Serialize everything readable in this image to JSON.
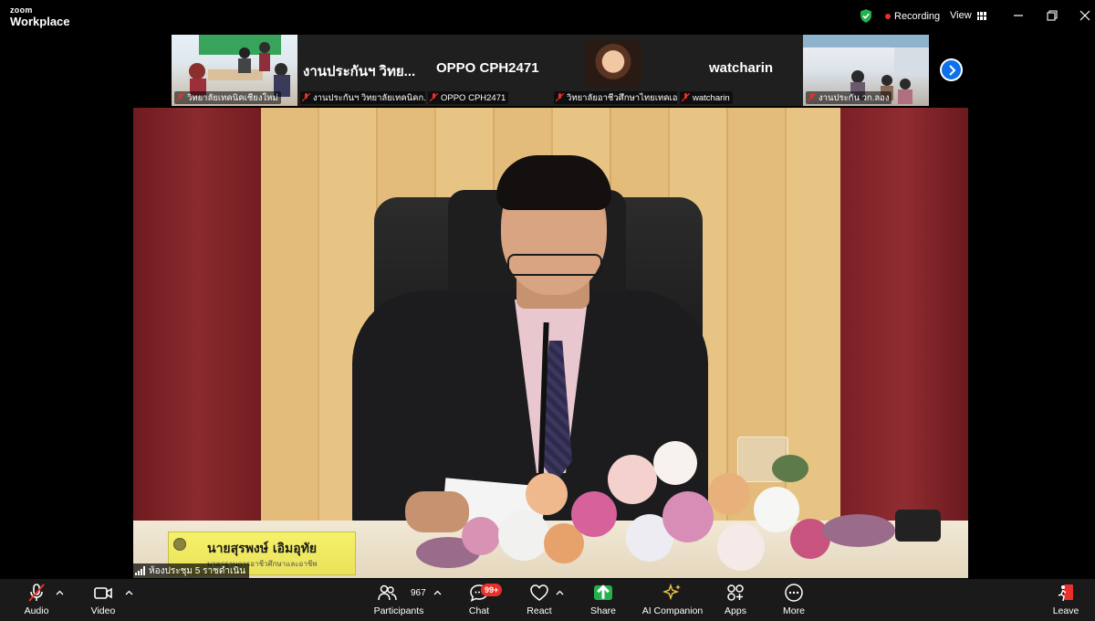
{
  "app": {
    "brand_small": "zoom",
    "brand_big": "Workplace"
  },
  "topbar": {
    "recording_label": "Recording",
    "view_label": "View",
    "colors": {
      "recording_dot": "#e8312a",
      "shield": "#23b14d"
    }
  },
  "thumbnails": [
    {
      "label": "วิทยาลัยเทคนิคเชียงใหม่",
      "kind": "video"
    },
    {
      "label": "งานประกันฯ วิทยาลัยเทคนิคก...",
      "name": "งานประกันฯ วิทย...",
      "kind": "name"
    },
    {
      "label": "OPPO CPH2471",
      "name": "OPPO CPH2471",
      "kind": "name"
    },
    {
      "label": "วิทยาลัยอาชีวศึกษาไทยเทคเอ...",
      "kind": "avatar"
    },
    {
      "label": "watcharin",
      "name": "watcharin",
      "kind": "name"
    },
    {
      "label": "งานประกัน วก.ลอง",
      "kind": "video"
    }
  ],
  "main_video": {
    "nameplate_name": "นายสุรพงษ์ เอิมอุทัย",
    "nameplate_subtitle": "มาตรฐานการอาชีวศึกษาและอาชีพ",
    "speaker_label": "ห้องประชุม 5 ราชดำเนิน"
  },
  "toolbar": {
    "audio": "Audio",
    "video": "Video",
    "participants": "Participants",
    "participants_count": "967",
    "chat": "Chat",
    "chat_badge": "99+",
    "react": "React",
    "share": "Share",
    "ai_companion": "AI Companion",
    "apps": "Apps",
    "more": "More",
    "leave": "Leave",
    "colors": {
      "share": "#23b14d",
      "leave": "#e8312a",
      "badge": "#e8312a",
      "mute": "#e8312a"
    }
  }
}
